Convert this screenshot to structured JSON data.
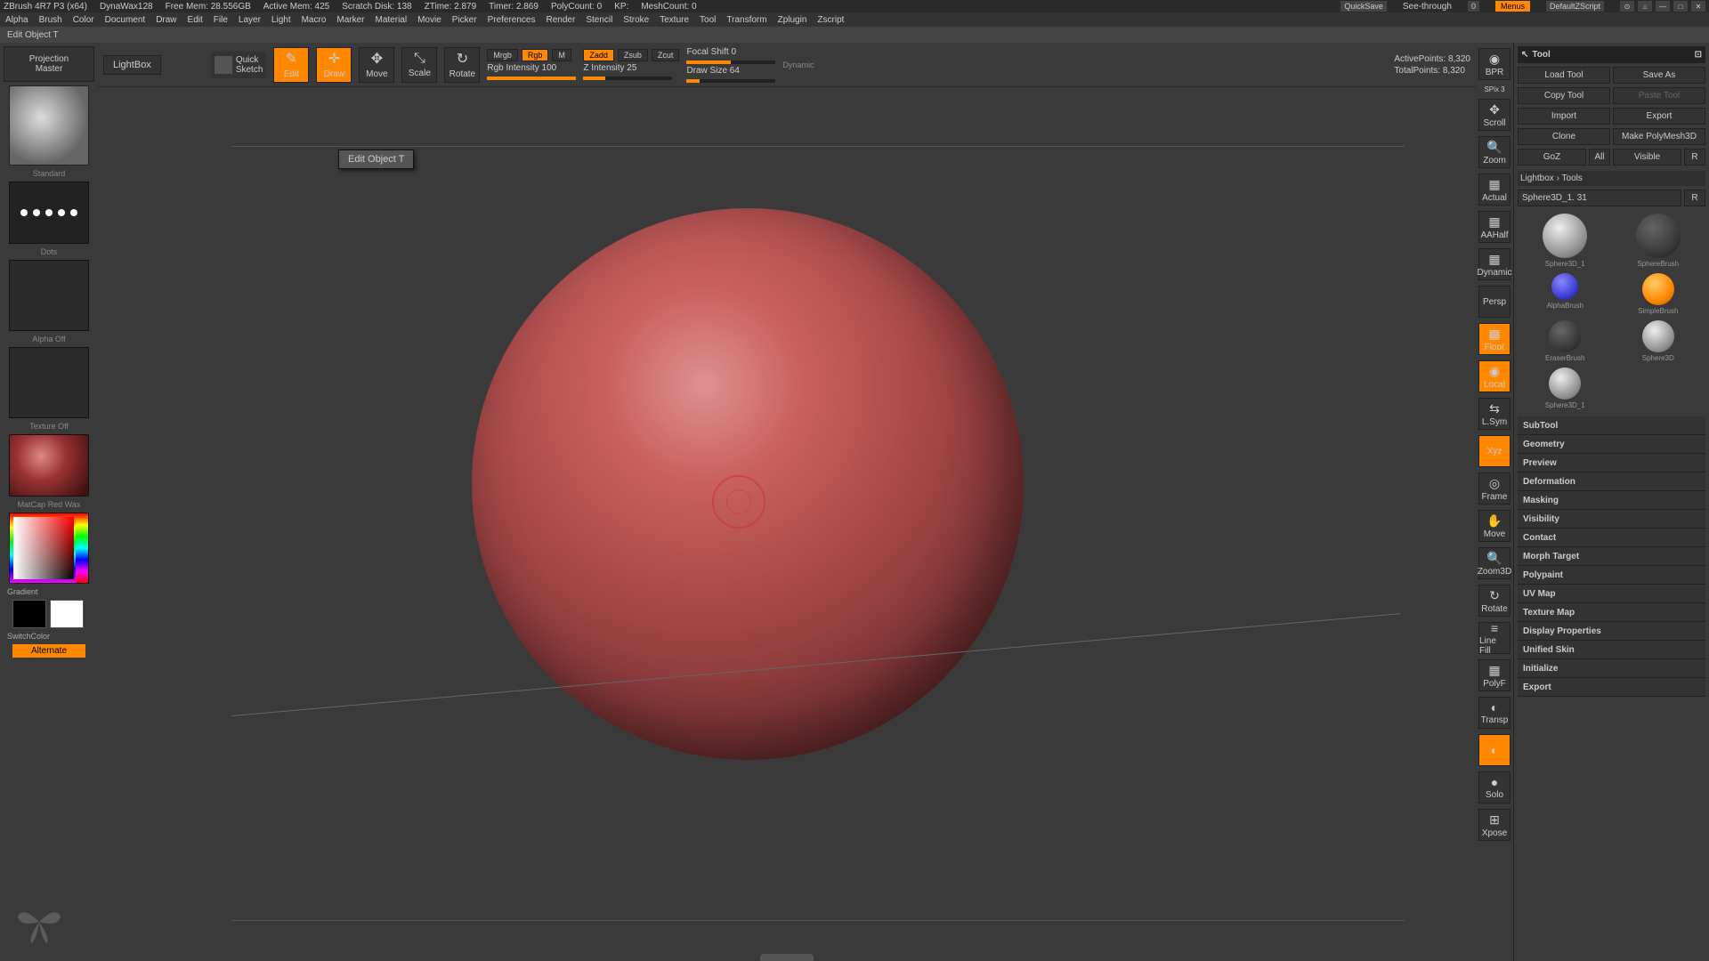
{
  "title": {
    "app": "ZBrush 4R7 P3 (x64)",
    "dynawax": "DynaWax128",
    "freemem": "Free Mem: 28.556GB",
    "activemem": "Active Mem: 425",
    "scratch": "Scratch Disk: 138",
    "ztime": "ZTime: 2.879",
    "timer": "Timer: 2.869",
    "polycount": "PolyCount: 0",
    "kp": "KP:",
    "meshcount": "MeshCount: 0",
    "quicksave": "QuickSave",
    "seethrough": "See-through",
    "seethrough_val": "0",
    "menus": "Menus",
    "script": "DefaultZScript"
  },
  "menu": [
    "Alpha",
    "Brush",
    "Color",
    "Document",
    "Draw",
    "Edit",
    "File",
    "Layer",
    "Light",
    "Macro",
    "Marker",
    "Material",
    "Movie",
    "Picker",
    "Preferences",
    "Render",
    "Stencil",
    "Stroke",
    "Texture",
    "Tool",
    "Transform",
    "Zplugin",
    "Zscript"
  ],
  "status": "Edit Object    T",
  "tooltip": "Edit Object    T",
  "left": {
    "proj1": "Projection",
    "proj2": "Master",
    "lightbox": "LightBox",
    "brush_name": "Standard",
    "stroke_name": "Dots",
    "alpha_name": "Alpha Off",
    "tex_name": "Texture Off",
    "mat_name": "MatCap Red Wax",
    "gradient": "Gradient",
    "switchcolor": "SwitchColor",
    "alternate": "Alternate"
  },
  "toolbar": {
    "quick": "Quick\nSketch",
    "edit": "Edit",
    "draw": "Draw",
    "move": "Move",
    "scale": "Scale",
    "rotate": "Rotate",
    "mrgb": "Mrgb",
    "rgb": "Rgb",
    "m": "M",
    "rgb_int": "Rgb Intensity 100",
    "zadd": "Zadd",
    "zsub": "Zsub",
    "zcut": "Zcut",
    "z_int": "Z Intensity 25",
    "focal": "Focal Shift 0",
    "drawsize": "Draw Size 64",
    "dynamic": "Dynamic",
    "active": "ActivePoints: 8,320",
    "total": "TotalPoints: 8,320"
  },
  "nav": {
    "bpr": "BPR",
    "spix": "SPix 3",
    "scroll": "Scroll",
    "zoom": "Zoom",
    "actual": "Actual",
    "aahalf": "AAHalf",
    "dynpersp": "Dynamic",
    "persp": "Persp",
    "floor": "Floor",
    "local": "Local",
    "lsym": "L.Sym",
    "xyz": "Xyz",
    "frame": "Frame",
    "move": "Move",
    "zoom3d": "Zoom3D",
    "rotate": "Rotate",
    "linefill": "Line Fill",
    "polyf": "PolyF",
    "transp": "Transp",
    "ghost": "Ghost",
    "solo": "Solo",
    "xpose": "Xpose"
  },
  "right": {
    "header": "Tool",
    "load": "Load Tool",
    "save": "Save As",
    "copy": "Copy Tool",
    "paste": "Paste Tool",
    "import": "Import",
    "export": "Export",
    "clone": "Clone",
    "makepoly": "Make PolyMesh3D",
    "goz": "GoZ",
    "all": "All",
    "visible": "Visible",
    "r": "R",
    "lightbox_tools": "Lightbox › Tools",
    "current_tool": "Sphere3D_1. 31",
    "tools": [
      {
        "name": "Sphere3D_1",
        "ball": ""
      },
      {
        "name": "SphereBrush",
        "ball": "dark"
      },
      {
        "name": "",
        "ball": "blue",
        "sub": "AlphaBrush"
      },
      {
        "name": "SimpleBrush",
        "ball": "orange"
      },
      {
        "name": "EraserBrush",
        "ball": "dark"
      },
      {
        "name": "Sphere3D",
        "ball": ""
      },
      {
        "name": "Sphere3D_1",
        "ball": ""
      }
    ],
    "sections": [
      "SubTool",
      "Geometry",
      "Preview",
      "Deformation",
      "Masking",
      "Visibility",
      "Contact",
      "Morph Target",
      "Polypaint",
      "UV Map",
      "Texture Map",
      "Display Properties",
      "Unified Skin",
      "Initialize",
      "Export"
    ]
  }
}
